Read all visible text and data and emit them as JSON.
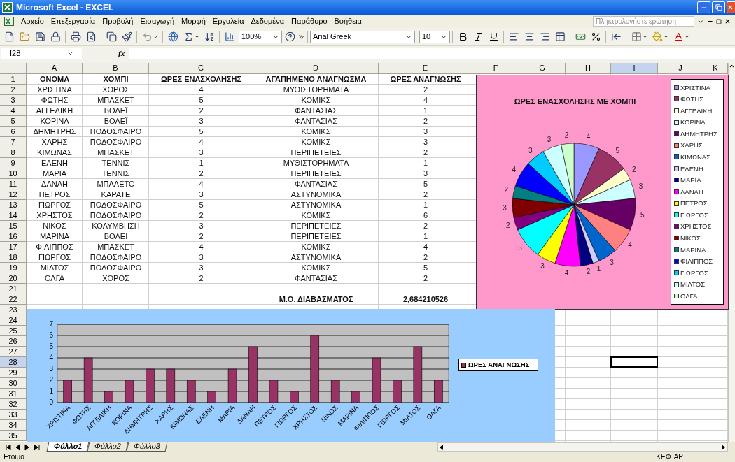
{
  "window": {
    "title": "Microsoft Excel - EXCEL"
  },
  "menu": {
    "items": [
      "Αρχείο",
      "Επεξεργασία",
      "Προβολή",
      "Εισαγωγή",
      "Μορφή",
      "Εργαλεία",
      "Δεδομένα",
      "Παράθυρο",
      "Βοήθεια"
    ],
    "help_placeholder": "Πληκτρολογήστε ερώτηση"
  },
  "toolbar": {
    "zoom": "100%",
    "font": "Arial Greek",
    "font_size": "10"
  },
  "formula_bar": {
    "name_box": "I28",
    "function_label": "fx"
  },
  "sheet": {
    "columns": [
      {
        "label": "A",
        "selected": false
      },
      {
        "label": "B",
        "selected": false
      },
      {
        "label": "C",
        "selected": false
      },
      {
        "label": "D",
        "selected": false
      },
      {
        "label": "E",
        "selected": false
      },
      {
        "label": "F",
        "selected": false
      },
      {
        "label": "G",
        "selected": false
      },
      {
        "label": "H",
        "selected": false
      },
      {
        "label": "I",
        "selected": true
      },
      {
        "label": "J",
        "selected": false
      },
      {
        "label": "K",
        "selected": false
      }
    ],
    "rows": [
      {
        "number": "1",
        "selected": false,
        "kind": "header",
        "cells": [
          "ΟΝΟΜΑ",
          "ΧΟΜΠΙ",
          "ΩΡΕΣ ΕΝΑΣΧΟΛΗΣΗΣ",
          "ΑΓΑΠΗΜΕΝΟ ΑΝΑΓΝΩΣΜΑ",
          "ΩΡΕΣ ΑΝΑΓΝΩΣΗΣ"
        ]
      },
      {
        "number": "2",
        "selected": false,
        "kind": "data",
        "cells": [
          "ΧΡΙΣΤΙΝΑ",
          "ΧΟΡΟΣ",
          "4",
          "ΜΥΘΙΣΤΟΡΗΜΑΤΑ",
          "2"
        ]
      },
      {
        "number": "3",
        "selected": false,
        "kind": "data",
        "cells": [
          "ΦΩΤΗΣ",
          "ΜΠΑΣΚΕΤ",
          "5",
          "ΚΟΜΙΚΣ",
          "4"
        ]
      },
      {
        "number": "4",
        "selected": false,
        "kind": "data",
        "cells": [
          "ΑΓΓΕΛΙΚΗ",
          "ΒΟΛΕΪ",
          "2",
          "ΦΑΝΤΑΣΙΑΣ",
          "1"
        ]
      },
      {
        "number": "5",
        "selected": false,
        "kind": "data",
        "cells": [
          "ΚΟΡΙΝΑ",
          "ΒΟΛΕΪ",
          "3",
          "ΦΑΝΤΑΣΙΑΣ",
          "2"
        ]
      },
      {
        "number": "6",
        "selected": false,
        "kind": "data",
        "cells": [
          "ΔΗΜΗΤΡΗΣ",
          "ΠΟΔΟΣΦΑΙΡΟ",
          "5",
          "ΚΟΜΙΚΣ",
          "3"
        ]
      },
      {
        "number": "7",
        "selected": false,
        "kind": "data",
        "cells": [
          "ΧΑΡΗΣ",
          "ΠΟΔΟΣΦΑΙΡΟ",
          "4",
          "ΚΟΜΙΚΣ",
          "3"
        ]
      },
      {
        "number": "8",
        "selected": false,
        "kind": "data",
        "cells": [
          "ΚΙΜΩΝΑΣ",
          "ΜΠΑΣΚΕΤ",
          "3",
          "ΠΕΡΙΠΕΤΕΙΕΣ",
          "2"
        ]
      },
      {
        "number": "9",
        "selected": false,
        "kind": "data",
        "cells": [
          "ΕΛΕΝΗ",
          "ΤΕΝΝΙΣ",
          "1",
          "ΜΥΘΙΣΤΟΡΗΜΑΤΑ",
          "1"
        ]
      },
      {
        "number": "10",
        "selected": false,
        "kind": "data",
        "cells": [
          "ΜΑΡΙΑ",
          "ΤΕΝΝΙΣ",
          "2",
          "ΠΕΡΙΠΕΤΕΙΕΣ",
          "3"
        ]
      },
      {
        "number": "11",
        "selected": false,
        "kind": "data",
        "cells": [
          "ΔΑΝΑΗ",
          "ΜΠΑΛΕΤΟ",
          "4",
          "ΦΑΝΤΑΣΙΑΣ",
          "5"
        ]
      },
      {
        "number": "12",
        "selected": false,
        "kind": "data",
        "cells": [
          "ΠΕΤΡΟΣ",
          "ΚΑΡΑΤΕ",
          "3",
          "ΑΣΤΥΝΟΜΙΚΑ",
          "2"
        ]
      },
      {
        "number": "13",
        "selected": false,
        "kind": "data",
        "cells": [
          "ΓΙΩΡΓΟΣ",
          "ΠΟΔΟΣΦΑΙΡΟ",
          "5",
          "ΑΣΤΥΝΟΜΙΚΑ",
          "1"
        ]
      },
      {
        "number": "14",
        "selected": false,
        "kind": "data",
        "cells": [
          "ΧΡΗΣΤΟΣ",
          "ΠΟΔΟΣΦΑΙΡΟ",
          "2",
          "ΚΟΜΙΚΣ",
          "6"
        ]
      },
      {
        "number": "15",
        "selected": false,
        "kind": "data",
        "cells": [
          "ΝΙΚΟΣ",
          "ΚΟΛΥΜΒΗΣΗ",
          "3",
          "ΠΕΡΙΠΕΤΕΙΕΣ",
          "2"
        ]
      },
      {
        "number": "16",
        "selected": false,
        "kind": "data",
        "cells": [
          "ΜΑΡΙΝΑ",
          "ΒΟΛΕΪ",
          "2",
          "ΠΕΡΙΠΕΤΕΙΕΣ",
          "1"
        ]
      },
      {
        "number": "17",
        "selected": false,
        "kind": "data",
        "cells": [
          "ΦΙΛΙΠΠΟΣ",
          "ΜΠΑΣΚΕΤ",
          "4",
          "ΚΟΜΙΚΣ",
          "4"
        ]
      },
      {
        "number": "18",
        "selected": false,
        "kind": "data",
        "cells": [
          "ΓΙΩΡΓΟΣ",
          "ΠΟΔΟΣΦΑΙΡΟ",
          "3",
          "ΑΣΤΥΝΟΜΙΚΑ",
          "2"
        ]
      },
      {
        "number": "19",
        "selected": false,
        "kind": "data",
        "cells": [
          "ΜΙΛΤΟΣ",
          "ΠΟΔΟΣΦΑΙΡΟ",
          "3",
          "ΚΟΜΙΚΣ",
          "5"
        ]
      },
      {
        "number": "20",
        "selected": false,
        "kind": "data",
        "cells": [
          "ΟΛΓΑ",
          "ΧΟΡΟΣ",
          "2",
          "ΦΑΝΤΑΣΙΑΣ",
          "2"
        ]
      },
      {
        "number": "21",
        "selected": false,
        "kind": "empty"
      },
      {
        "number": "22",
        "selected": false,
        "kind": "summary",
        "label": "Μ.Ο. ΔΙΑΒΑΣΜΑΤΟΣ",
        "value": "2,684210526"
      },
      {
        "number": "23",
        "selected": false,
        "kind": "empty"
      },
      {
        "number": "24",
        "selected": false,
        "kind": "empty"
      },
      {
        "number": "25",
        "selected": false,
        "kind": "empty"
      },
      {
        "number": "26",
        "selected": false,
        "kind": "empty"
      },
      {
        "number": "27",
        "selected": false,
        "kind": "empty"
      },
      {
        "number": "28",
        "selected": true,
        "kind": "empty"
      },
      {
        "number": "29",
        "selected": false,
        "kind": "empty"
      },
      {
        "number": "30",
        "selected": false,
        "kind": "empty"
      },
      {
        "number": "31",
        "selected": false,
        "kind": "empty"
      },
      {
        "number": "32",
        "selected": false,
        "kind": "empty"
      },
      {
        "number": "33",
        "selected": false,
        "kind": "empty"
      },
      {
        "number": "34",
        "selected": false,
        "kind": "empty"
      },
      {
        "number": "35",
        "selected": false,
        "kind": "empty"
      }
    ]
  },
  "pie_chart": {
    "chart_data": {
      "type": "pie",
      "title": "ΩΡΕΣ ΕΝΑΣΧΟΛΗΣΗΣ ΜΕ ΧΟΜΠΙ",
      "categories": [
        "ΧΡΙΣΤΙΝΑ",
        "ΦΩΤΗΣ",
        "ΑΓΓΕΛΙΚΗ",
        "ΚΟΡΙΝΑ",
        "ΔΗΜΗΤΡΗΣ",
        "ΧΑΡΗΣ",
        "ΚΙΜΩΝΑΣ",
        "ΕΛΕΝΗ",
        "ΜΑΡΙΑ",
        "ΔΑΝΑΗ",
        "ΠΕΤΡΟΣ",
        "ΓΙΩΡΓΟΣ",
        "ΧΡΗΣΤΟΣ",
        "ΝΙΚΟΣ",
        "ΜΑΡΙΝΑ",
        "ΦΙΛΙΠΠΟΣ",
        "ΓΙΩΡΓΟΣ",
        "ΜΙΛΤΟΣ",
        "ΟΛΓΑ"
      ],
      "values": [
        4,
        5,
        2,
        3,
        5,
        4,
        3,
        1,
        2,
        4,
        3,
        5,
        2,
        3,
        2,
        4,
        3,
        3,
        2
      ],
      "colors": [
        "#9999ff",
        "#993366",
        "#ffffcc",
        "#ccffff",
        "#660066",
        "#ff8080",
        "#0066cc",
        "#ccccff",
        "#000080",
        "#ff00ff",
        "#ffff00",
        "#00ffff",
        "#800080",
        "#800000",
        "#008080",
        "#0000ff",
        "#00ccff",
        "#ccffff",
        "#ccffcc"
      ],
      "data_labels": true,
      "legend": "right"
    }
  },
  "bar_chart": {
    "chart_data": {
      "type": "bar",
      "categories": [
        "ΧΡΙΣΤΙΝΑ",
        "ΦΩΤΗΣ",
        "ΑΓΓΕΛΙΚΗ",
        "ΚΟΡΙΝΑ",
        "ΔΗΜΗΤΡΗΣ",
        "ΧΑΡΗΣ",
        "ΚΙΜΩΝΑΣ",
        "ΕΛΕΝΗ",
        "ΜΑΡΙΑ",
        "ΔΑΝΑΗ",
        "ΠΕΤΡΟΣ",
        "ΓΙΩΡΓΟΣ",
        "ΧΡΗΣΤΟΣ",
        "ΝΙΚΟΣ",
        "ΜΑΡΙΝΑ",
        "ΦΙΛΙΠΠΟΣ",
        "ΓΙΩΡΓΟΣ",
        "ΜΙΛΤΟΣ",
        "ΟΛΓΑ"
      ],
      "series": [
        {
          "name": "ΩΡΕΣ ΑΝΑΓΝΩΣΗΣ",
          "color": "#993366",
          "values": [
            2,
            4,
            1,
            2,
            3,
            3,
            2,
            1,
            3,
            5,
            2,
            1,
            6,
            2,
            1,
            4,
            2,
            5,
            2
          ]
        }
      ],
      "ylim": [
        0,
        7
      ],
      "yticks": [
        0,
        1,
        2,
        3,
        4,
        5,
        6,
        7
      ],
      "grid": true,
      "legend": "right"
    }
  },
  "sheet_tabs": [
    {
      "label": "Φύλλο1",
      "selected": true
    },
    {
      "label": "Φύλλο2",
      "selected": false
    },
    {
      "label": "Φύλλο3",
      "selected": false
    }
  ],
  "status_bar": {
    "status": "Έτοιμο",
    "indicators": [
      "ΚΕΦ",
      "ΑΡ"
    ]
  }
}
